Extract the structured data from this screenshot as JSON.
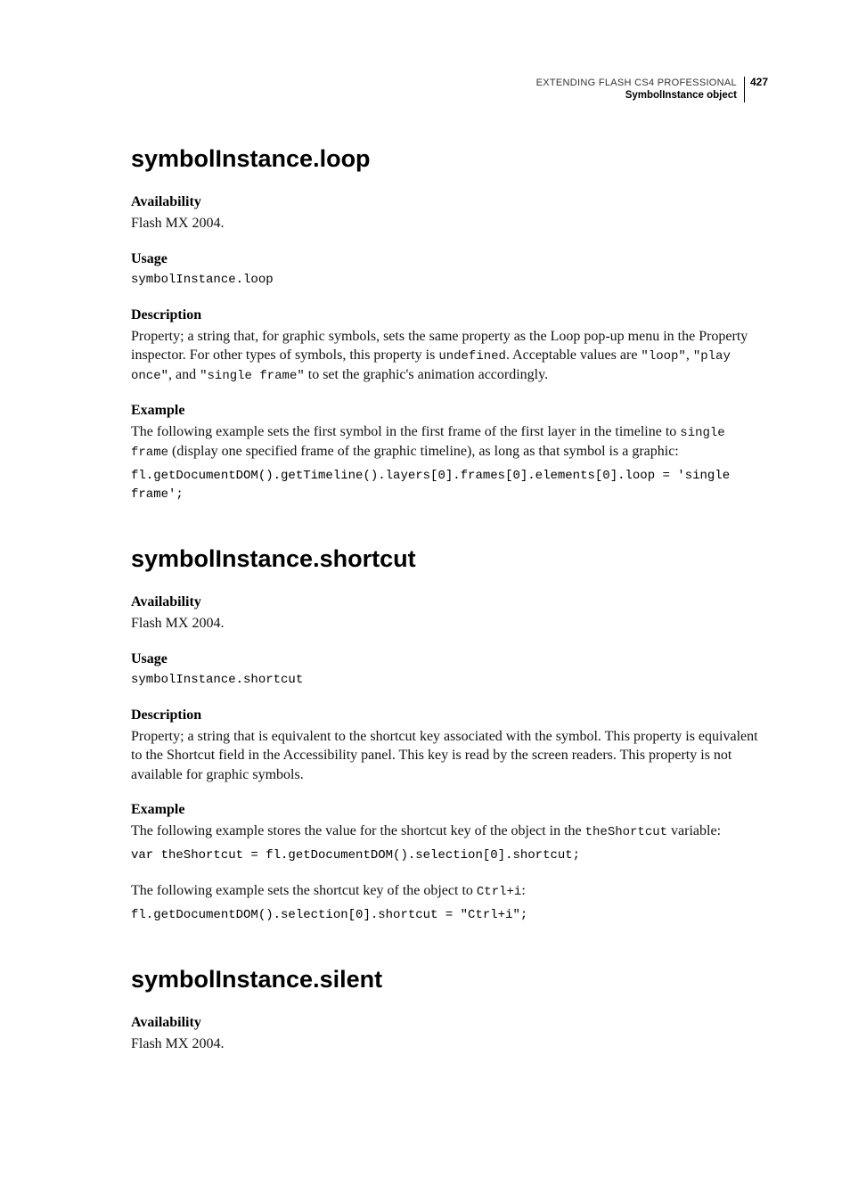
{
  "header": {
    "doc_title": "EXTENDING FLASH CS4 PROFESSIONAL",
    "section": "SymbolInstance object",
    "page_no": "427"
  },
  "s1": {
    "title": "symbolInstance.loop",
    "avail_h": "Availability",
    "avail_t": "Flash MX 2004.",
    "usage_h": "Usage",
    "usage_c": "symbolInstance.loop",
    "desc_h": "Description",
    "desc_p1a": "Property; a string that, for graphic symbols, sets the same property as the Loop pop-up menu in the Property inspector. For other types of symbols, this property is ",
    "desc_c1": "undefined",
    "desc_p1b": ". Acceptable values are ",
    "desc_c2": "\"loop\"",
    "desc_p1c": ", ",
    "desc_c3": "\"play once\"",
    "desc_p1d": ", and ",
    "desc_c4": "\"single frame\"",
    "desc_p1e": " to set the graphic's animation accordingly.",
    "ex_h": "Example",
    "ex_p_a": "The following example sets the first symbol in the first frame of the first layer in the timeline to ",
    "ex_c": "single frame",
    "ex_p_b": " (display one specified frame of the graphic timeline), as long as that symbol is a graphic:",
    "ex_code": "fl.getDocumentDOM().getTimeline().layers[0].frames[0].elements[0].loop = 'single frame';"
  },
  "s2": {
    "title": "symbolInstance.shortcut",
    "avail_h": "Availability",
    "avail_t": "Flash MX 2004.",
    "usage_h": "Usage",
    "usage_c": "symbolInstance.shortcut",
    "desc_h": "Description",
    "desc_p": "Property; a string that is equivalent to the shortcut key associated with the symbol. This property is equivalent to the Shortcut field in the Accessibility panel. This key is read by the screen readers. This property is not available for graphic symbols.",
    "ex_h": "Example",
    "ex_p1a": "The following example stores the value for the shortcut key of the object in the ",
    "ex_c1": "theShortcut",
    "ex_p1b": " variable:",
    "ex_code1": "var theShortcut = fl.getDocumentDOM().selection[0].shortcut;",
    "ex_p2a": "The following example sets the shortcut key of the object to ",
    "ex_c2": "Ctrl+i",
    "ex_p2b": ":",
    "ex_code2": "fl.getDocumentDOM().selection[0].shortcut = \"Ctrl+i\";"
  },
  "s3": {
    "title": "symbolInstance.silent",
    "avail_h": "Availability",
    "avail_t": "Flash MX 2004."
  }
}
